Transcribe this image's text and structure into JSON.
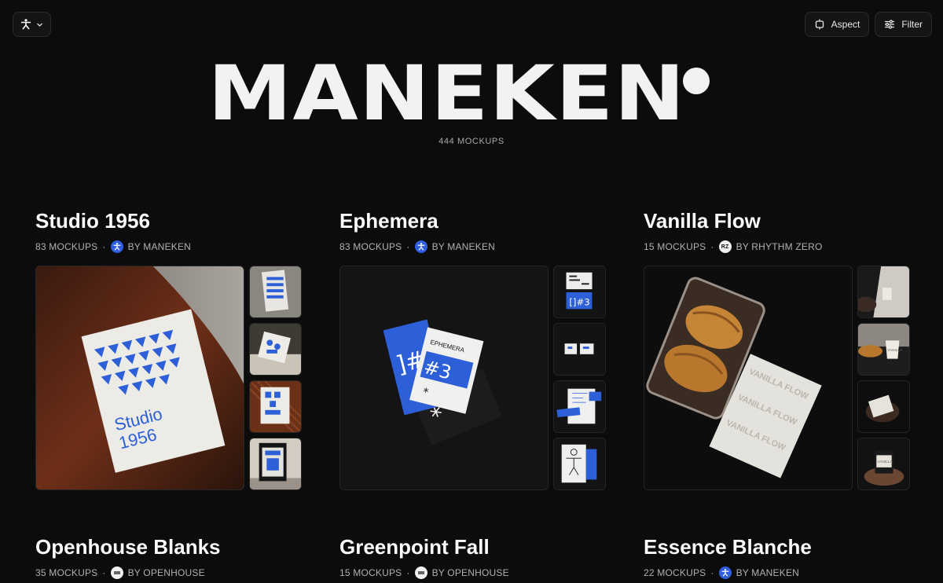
{
  "toolbar": {
    "aspect_label": "Aspect",
    "filter_label": "Filter"
  },
  "hero": {
    "title": "MANEKEN",
    "count": "444 MOCKUPS"
  },
  "collections": [
    {
      "title": "Studio 1956",
      "count": "83 MOCKUPS",
      "author": "BY MANEKEN",
      "avatar": "maneken-logo"
    },
    {
      "title": "Ephemera",
      "count": "83 MOCKUPS",
      "author": "BY MANEKEN",
      "avatar": "maneken-logo"
    },
    {
      "title": "Vanilla Flow",
      "count": "15 MOCKUPS",
      "author": "BY RHYTHM ZERO",
      "avatar_text": "RZ"
    },
    {
      "title": "Openhouse Blanks",
      "count": "35 MOCKUPS",
      "author": "BY OPENHOUSE",
      "avatar": "openhouse-logo"
    },
    {
      "title": "Greenpoint Fall",
      "count": "15 MOCKUPS",
      "author": "BY OPENHOUSE",
      "avatar": "openhouse-logo"
    },
    {
      "title": "Essence Blanche",
      "count": "22 MOCKUPS",
      "author": "BY MANEKEN",
      "avatar": "maneken-logo"
    }
  ],
  "mockup_text": {
    "studio_poster": [
      "Studio",
      "1956"
    ],
    "ephemera_mark": "]#3",
    "ephemera_word": "EPHEMERA",
    "vanilla_label": "VANILLA FLOW"
  },
  "colors": {
    "background": "#0c0c0c",
    "accent_blue": "#2f5fe0",
    "text_muted": "#b0b0b0"
  }
}
